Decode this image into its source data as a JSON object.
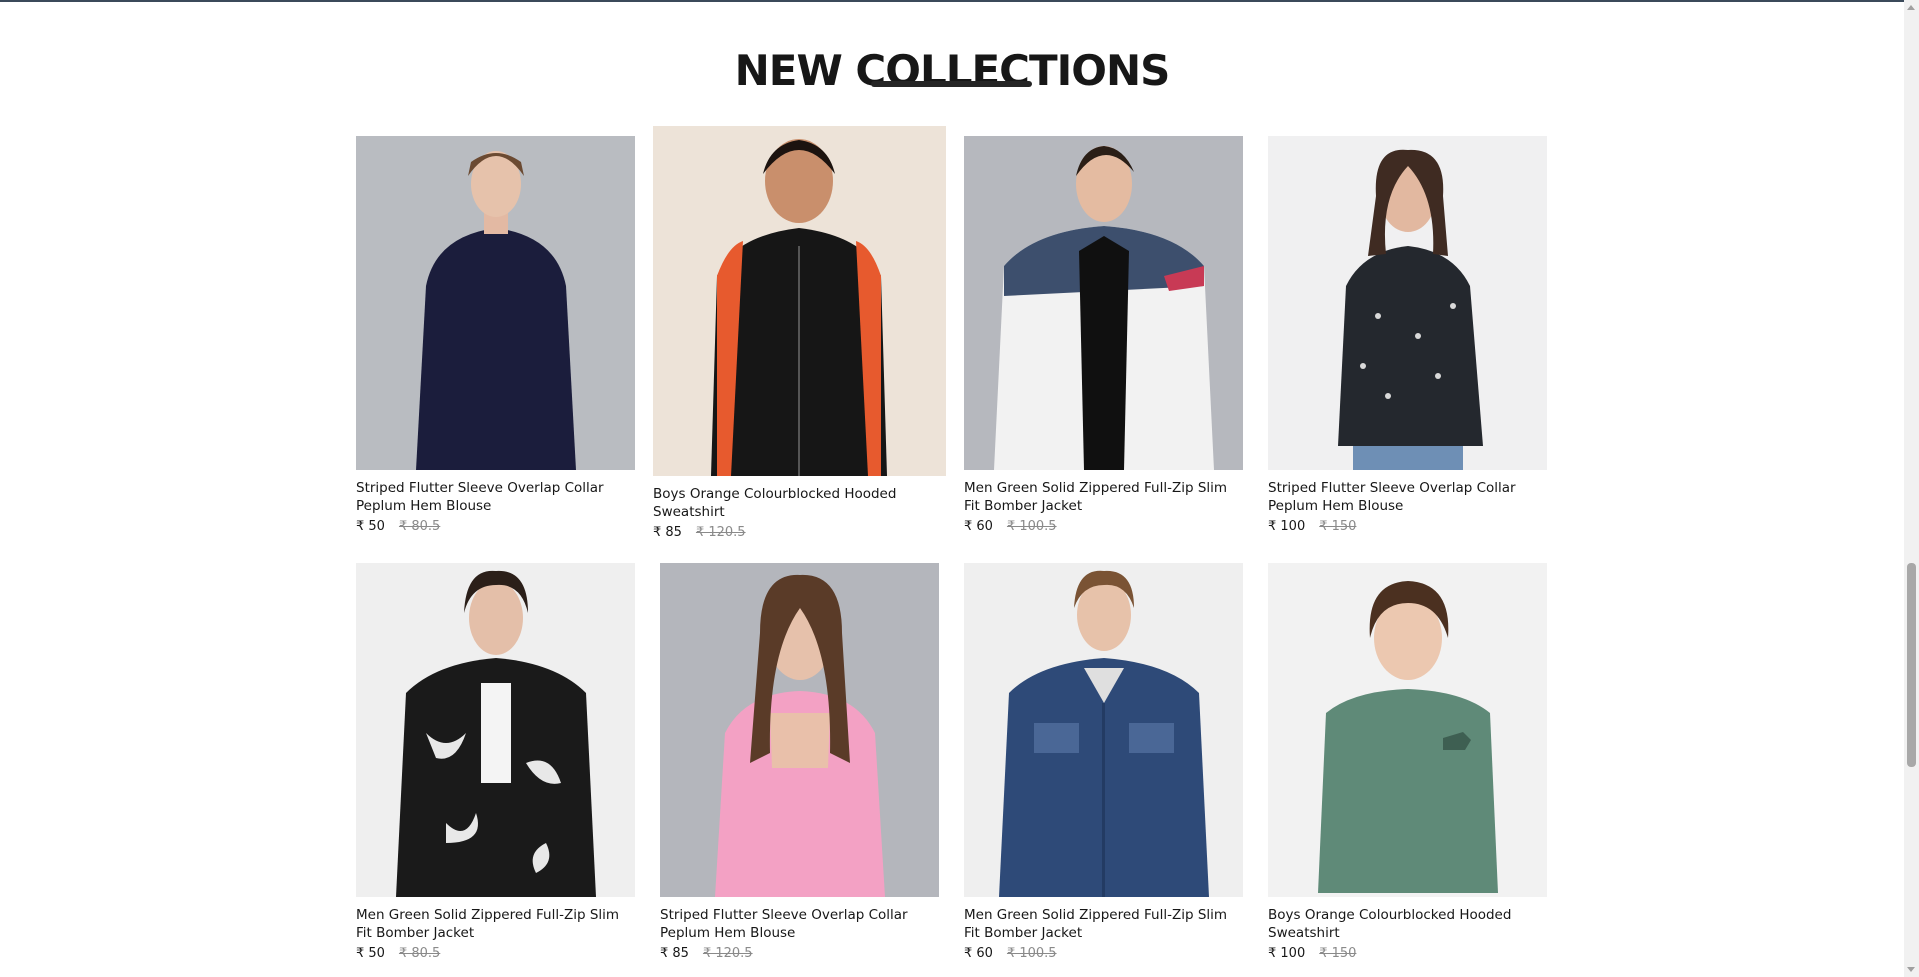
{
  "section": {
    "title": "NEW COLLECTIONS"
  },
  "currency": "₹",
  "products": [
    {
      "name": "Striped Flutter Sleeve Overlap Collar Peplum Hem Blouse",
      "price": "₹ 50",
      "old_price": "₹ 80.5"
    },
    {
      "name": "Boys Orange Colourblocked Hooded Sweatshirt",
      "price": "₹ 85",
      "old_price": "₹ 120.5"
    },
    {
      "name": "Men Green Solid Zippered Full-Zip Slim Fit Bomber Jacket",
      "price": "₹ 60",
      "old_price": "₹ 100.5"
    },
    {
      "name": "Striped Flutter Sleeve Overlap Collar Peplum Hem Blouse",
      "price": "₹ 100",
      "old_price": "₹ 150"
    },
    {
      "name": "Men Green Solid Zippered Full-Zip Slim Fit Bomber Jacket",
      "price": "₹ 50",
      "old_price": "₹ 80.5"
    },
    {
      "name": "Striped Flutter Sleeve Overlap Collar Peplum Hem Blouse",
      "price": "₹ 85",
      "old_price": "₹ 120.5"
    },
    {
      "name": "Men Green Solid Zippered Full-Zip Slim Fit Bomber Jacket",
      "price": "₹ 60",
      "old_price": "₹ 100.5"
    },
    {
      "name": "Boys Orange Colourblocked Hooded Sweatshirt",
      "price": "₹ 100",
      "old_price": "₹ 150"
    }
  ],
  "colors": {
    "text": "#171717",
    "muted": "#8a8a8a",
    "underline": "#252525"
  }
}
